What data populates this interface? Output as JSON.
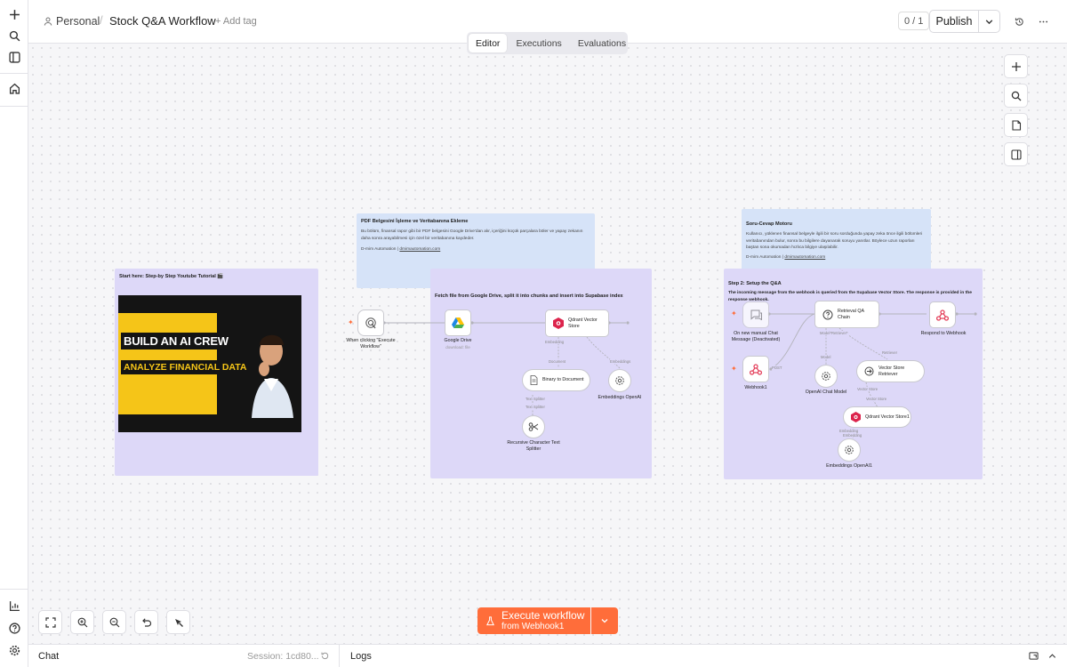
{
  "header": {
    "workspace": "Personal",
    "separator": "/",
    "workflow_title": "Stock Q&A Workflow",
    "add_tag": "+ Add tag",
    "counter": "0 / 1",
    "publish": "Publish"
  },
  "tabs": [
    "Editor",
    "Executions",
    "Evaluations"
  ],
  "active_tab": "Editor",
  "stickies": {
    "tutorial": {
      "title": "Start here: Step-by Step Youtube Tutorial 🎬"
    },
    "thumbnail": {
      "line1": "BUILD AN AI CREW",
      "line2": "ANALYZE FINANCIAL DATA"
    },
    "pdf": {
      "title": "PDF Belgesini İşleme ve Veritabanına Ekleme",
      "body": "Bu bölüm, finansal rapor gibi bir PDF belgesini Google Drive'dan alır, içeriğini küçük parçalara böler ve yapay zekanın daha sonra arayabilmesi için özel bir veritabanına kaydeder.",
      "credit": "D-mim Automation |",
      "link": "dmimautomation.com"
    },
    "step1": {
      "title": "Fetch file from Google Drive, split it into chunks and insert into Supabase index"
    },
    "qa": {
      "title": "Soru-Cevap Motoru",
      "body": "Kullanıcı, yüklenen finansal belgeyle ilgili bir soru sorduğunda yapay zeka önce ilgili bölümleri veritabanından bulur, sonra bu bilgilere dayanarak soruyu yanıtlar. Böylece uzun raporları baştan sona okumadan hızlıca bilgiye ulaşılabilir.",
      "credit": "D-mim Automation |",
      "link": "dmimautomation.com"
    },
    "step2": {
      "title": "Step 2: Setup the Q&A",
      "body": "The incoming message from the webhook is queried from the Supabase Vector Store. The response is provided in the response webhook."
    }
  },
  "nodes": {
    "manual_trigger": "When clicking \"Execute Workflow\"",
    "google_drive": "Google Drive",
    "google_drive_sub": "download: file",
    "qdrant1": "Qdrant Vector Store",
    "binary_doc": "Binary to Document",
    "embeddings1": "Embeddings OpenAI",
    "splitter": "Recursive Character Text Splitter",
    "chat_trigger": "On new manual Chat Message (Deactivated)",
    "webhook1": "Webhook1",
    "retrieval_qa": "Retrieval QA Chain",
    "respond": "Respond to Webhook",
    "chat_model": "OpenAI Chat Model",
    "vs_retriever": "Vector Store Retriever",
    "qdrant2": "Qdrant Vector Store1",
    "embeddings2": "Embeddings OpenAI1"
  },
  "edge_labels": {
    "embedding": "Embedding",
    "document": "Document",
    "embeddings": "Embeddings",
    "text_splitter": "Text Splitter",
    "model": "Model",
    "retriever": "Retriever",
    "vector_store": "Vector Store",
    "post": "POST"
  },
  "execute": {
    "main": "Execute workflow",
    "sub": "from Webhook1"
  },
  "bottom": {
    "chat": "Chat",
    "session": "Session: 1cd80...",
    "logs": "Logs"
  },
  "colors": {
    "accent": "#ff6d3a",
    "sticky_purple": "#ddd8f8",
    "sticky_blue": "#d6e3f8"
  }
}
